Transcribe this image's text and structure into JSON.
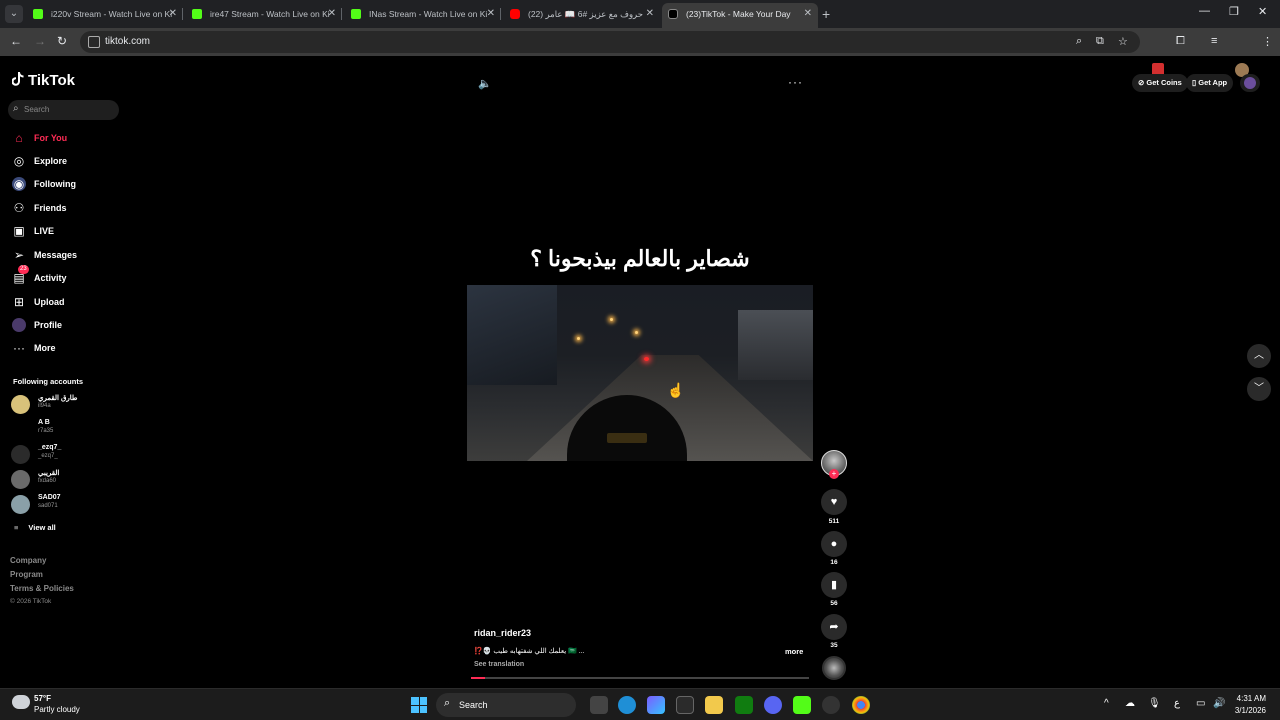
{
  "browser": {
    "tabs": [
      {
        "title": "i220v Stream - Watch Live on Ki",
        "icon": "kick-icon"
      },
      {
        "title": "ire47 Stream - Watch Live on Ki",
        "icon": "kick-icon"
      },
      {
        "title": "INas Stream - Watch Live on Ki",
        "icon": "kick-icon"
      },
      {
        "title": "(22) حروف مع عزيز #6 📖 عامر",
        "icon": "youtube-icon"
      },
      {
        "title": "(23)TikTok - Make Your Day",
        "icon": "tiktok-icon"
      }
    ],
    "url": "tiktok.com"
  },
  "sidebar": {
    "logo": "TikTok",
    "search_placeholder": "Search",
    "nav": [
      {
        "label": "For You",
        "icon": "home-icon"
      },
      {
        "label": "Explore",
        "icon": "compass-icon"
      },
      {
        "label": "Following",
        "icon": "following-icon"
      },
      {
        "label": "Friends",
        "icon": "friends-icon"
      },
      {
        "label": "LIVE",
        "icon": "live-icon"
      },
      {
        "label": "Messages",
        "icon": "messages-icon"
      },
      {
        "label": "Activity",
        "icon": "activity-icon",
        "badge": "23"
      },
      {
        "label": "Upload",
        "icon": "upload-icon"
      },
      {
        "label": "Profile",
        "icon": "profile-icon"
      },
      {
        "label": "More",
        "icon": "more-icon"
      }
    ],
    "following_title": "Following accounts",
    "accounts": [
      {
        "name": "طارق القمري",
        "handle": "il94a"
      },
      {
        "name": "A B",
        "handle": "r7a35"
      },
      {
        "name": "_ezq7_",
        "handle": "_ezq7_"
      },
      {
        "name": "القريبي",
        "handle": "fxda60"
      },
      {
        "name": "SAD07",
        "handle": "sad071"
      }
    ],
    "view_all": "View all",
    "footer": [
      "Company",
      "Program",
      "Terms & Policies"
    ],
    "copyright": "© 2026 TikTok"
  },
  "header": {
    "get_coins": "Get Coins",
    "get_app": "Get App"
  },
  "video": {
    "overlay_text": "شصاير بالعالم بيذبحونا ؟",
    "author": "ridan_rider23",
    "description": "⁉️💀 يعلمك اللي شفتهابه طيب 🇸🇦 ...",
    "more": "more",
    "see_translation": "See translation",
    "progress": 0.04,
    "likes": "511",
    "comments": "16",
    "saves": "56",
    "shares": "35"
  },
  "taskbar": {
    "temperature": "57°F",
    "weather": "Partly cloudy",
    "search": "Search",
    "time": "4:31 AM",
    "date": "3/1/2026"
  },
  "colors": {
    "accent": "#fe2c55",
    "background": "#000000"
  }
}
